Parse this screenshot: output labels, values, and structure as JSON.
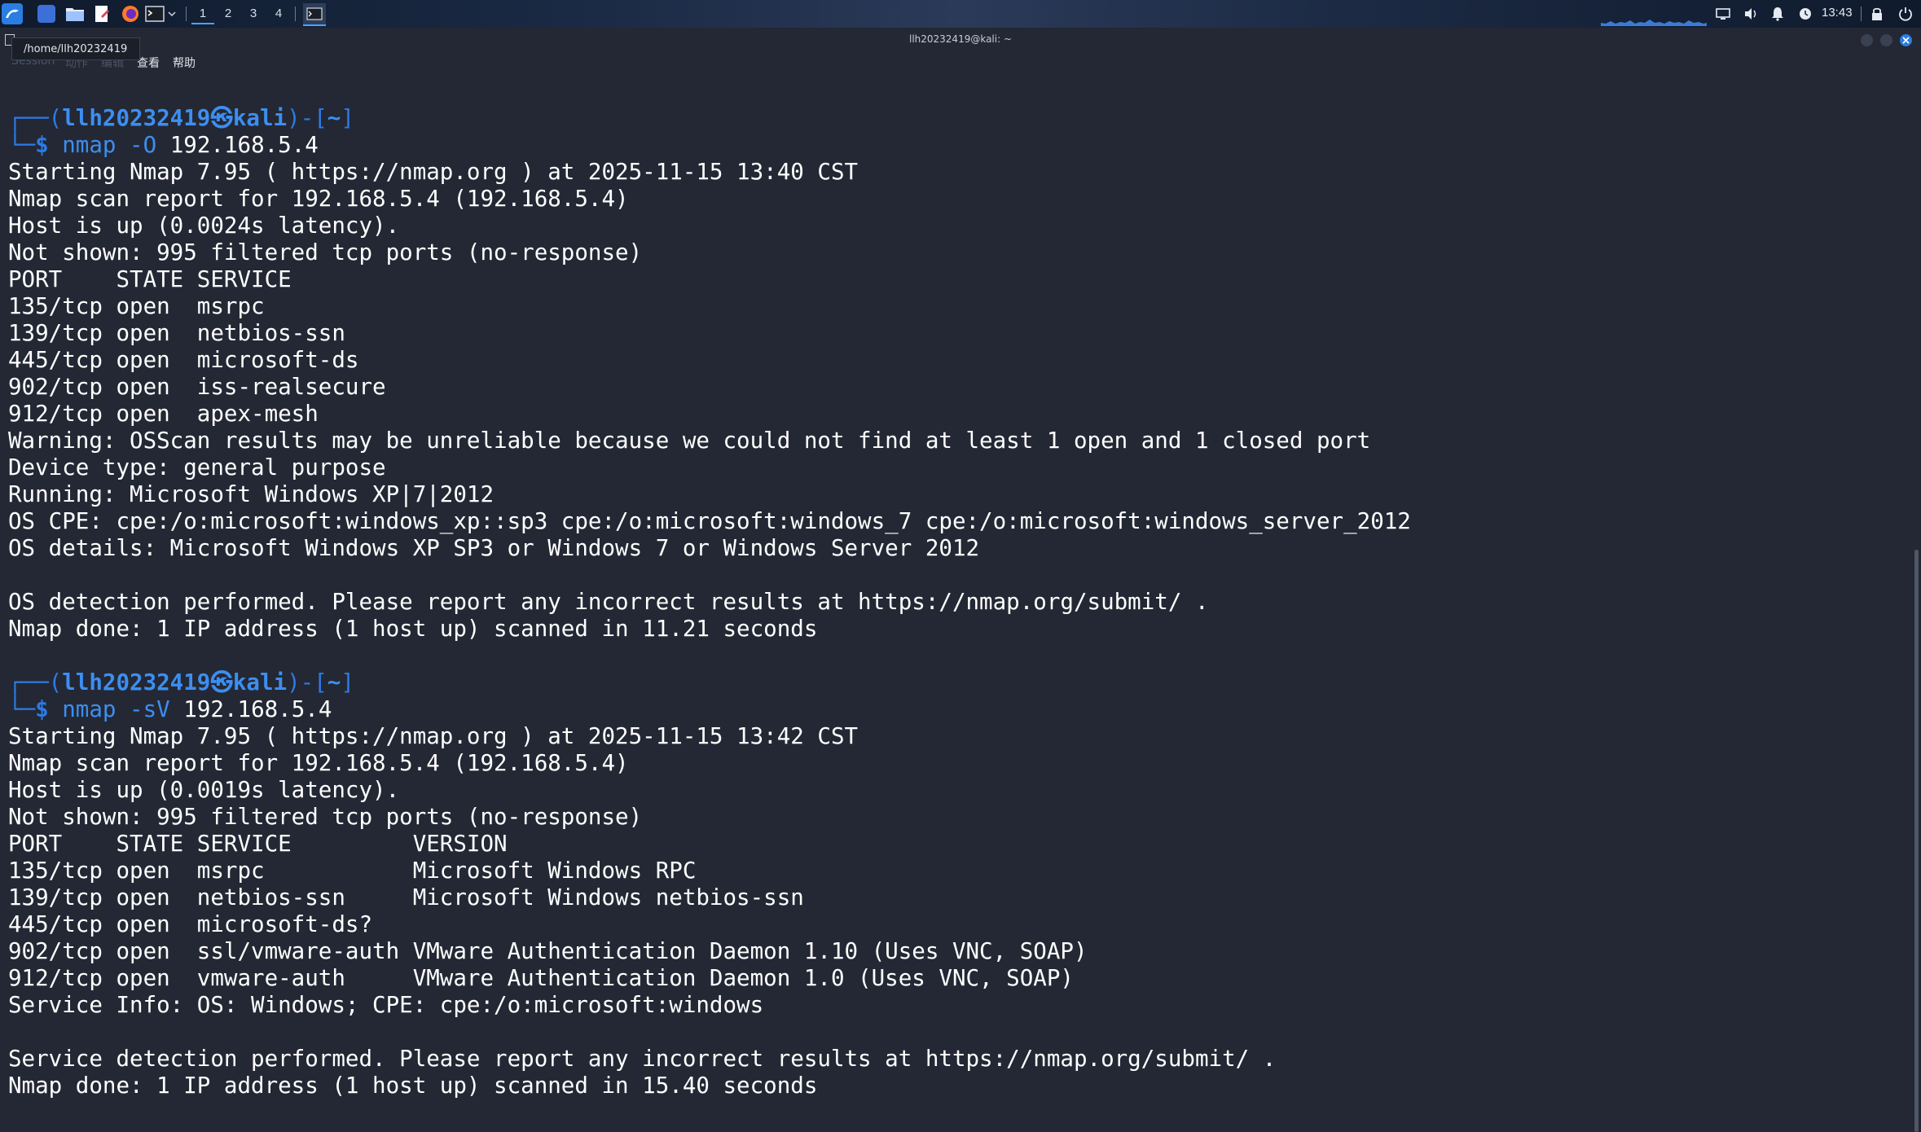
{
  "panel": {
    "workspaces": [
      "1",
      "2",
      "3",
      "4"
    ],
    "active_workspace": "1",
    "clock": "13:43",
    "accent_color": "#4aa3ff"
  },
  "window": {
    "title": "llh20232419@kali: ~",
    "tooltip": "/home/llh20232419"
  },
  "menubar": {
    "items": [
      "Session",
      "动作",
      "编辑",
      "查看",
      "帮助"
    ]
  },
  "terminal": {
    "prompts": [
      {
        "box_top": "┌──(",
        "user": "llh20232419㉿kali",
        "box_end": ")-[",
        "path": "~",
        "box_close": "]",
        "box_bottom": "└─",
        "dollar": "$",
        "command": "nmap",
        "args": "-O",
        "target": "192.168.5.4"
      },
      {
        "box_top": "┌──(",
        "user": "llh20232419㉿kali",
        "box_end": ")-[",
        "path": "~",
        "box_close": "]",
        "box_bottom": "└─",
        "dollar": "$",
        "command": "nmap",
        "args": "-sV",
        "target": "192.168.5.4"
      }
    ],
    "output1": [
      "Starting Nmap 7.95 ( https://nmap.org ) at 2025-11-15 13:40 CST",
      "Nmap scan report for 192.168.5.4 (192.168.5.4)",
      "Host is up (0.0024s latency).",
      "Not shown: 995 filtered tcp ports (no-response)",
      "PORT    STATE SERVICE",
      "135/tcp open  msrpc",
      "139/tcp open  netbios-ssn",
      "445/tcp open  microsoft-ds",
      "902/tcp open  iss-realsecure",
      "912/tcp open  apex-mesh",
      "Warning: OSScan results may be unreliable because we could not find at least 1 open and 1 closed port",
      "Device type: general purpose",
      "Running: Microsoft Windows XP|7|2012",
      "OS CPE: cpe:/o:microsoft:windows_xp::sp3 cpe:/o:microsoft:windows_7 cpe:/o:microsoft:windows_server_2012",
      "OS details: Microsoft Windows XP SP3 or Windows 7 or Windows Server 2012",
      "",
      "OS detection performed. Please report any incorrect results at https://nmap.org/submit/ .",
      "Nmap done: 1 IP address (1 host up) scanned in 11.21 seconds"
    ],
    "output2": [
      "Starting Nmap 7.95 ( https://nmap.org ) at 2025-11-15 13:42 CST",
      "Nmap scan report for 192.168.5.4 (192.168.5.4)",
      "Host is up (0.0019s latency).",
      "Not shown: 995 filtered tcp ports (no-response)",
      "PORT    STATE SERVICE         VERSION",
      "135/tcp open  msrpc           Microsoft Windows RPC",
      "139/tcp open  netbios-ssn     Microsoft Windows netbios-ssn",
      "445/tcp open  microsoft-ds?",
      "902/tcp open  ssl/vmware-auth VMware Authentication Daemon 1.10 (Uses VNC, SOAP)",
      "912/tcp open  vmware-auth     VMware Authentication Daemon 1.0 (Uses VNC, SOAP)",
      "Service Info: OS: Windows; CPE: cpe:/o:microsoft:windows",
      "",
      "Service detection performed. Please report any incorrect results at https://nmap.org/submit/ .",
      "Nmap done: 1 IP address (1 host up) scanned in 15.40 seconds"
    ],
    "colors": {
      "background": "#232834",
      "text": "#ffffff",
      "prompt": "#2c7be5"
    }
  }
}
